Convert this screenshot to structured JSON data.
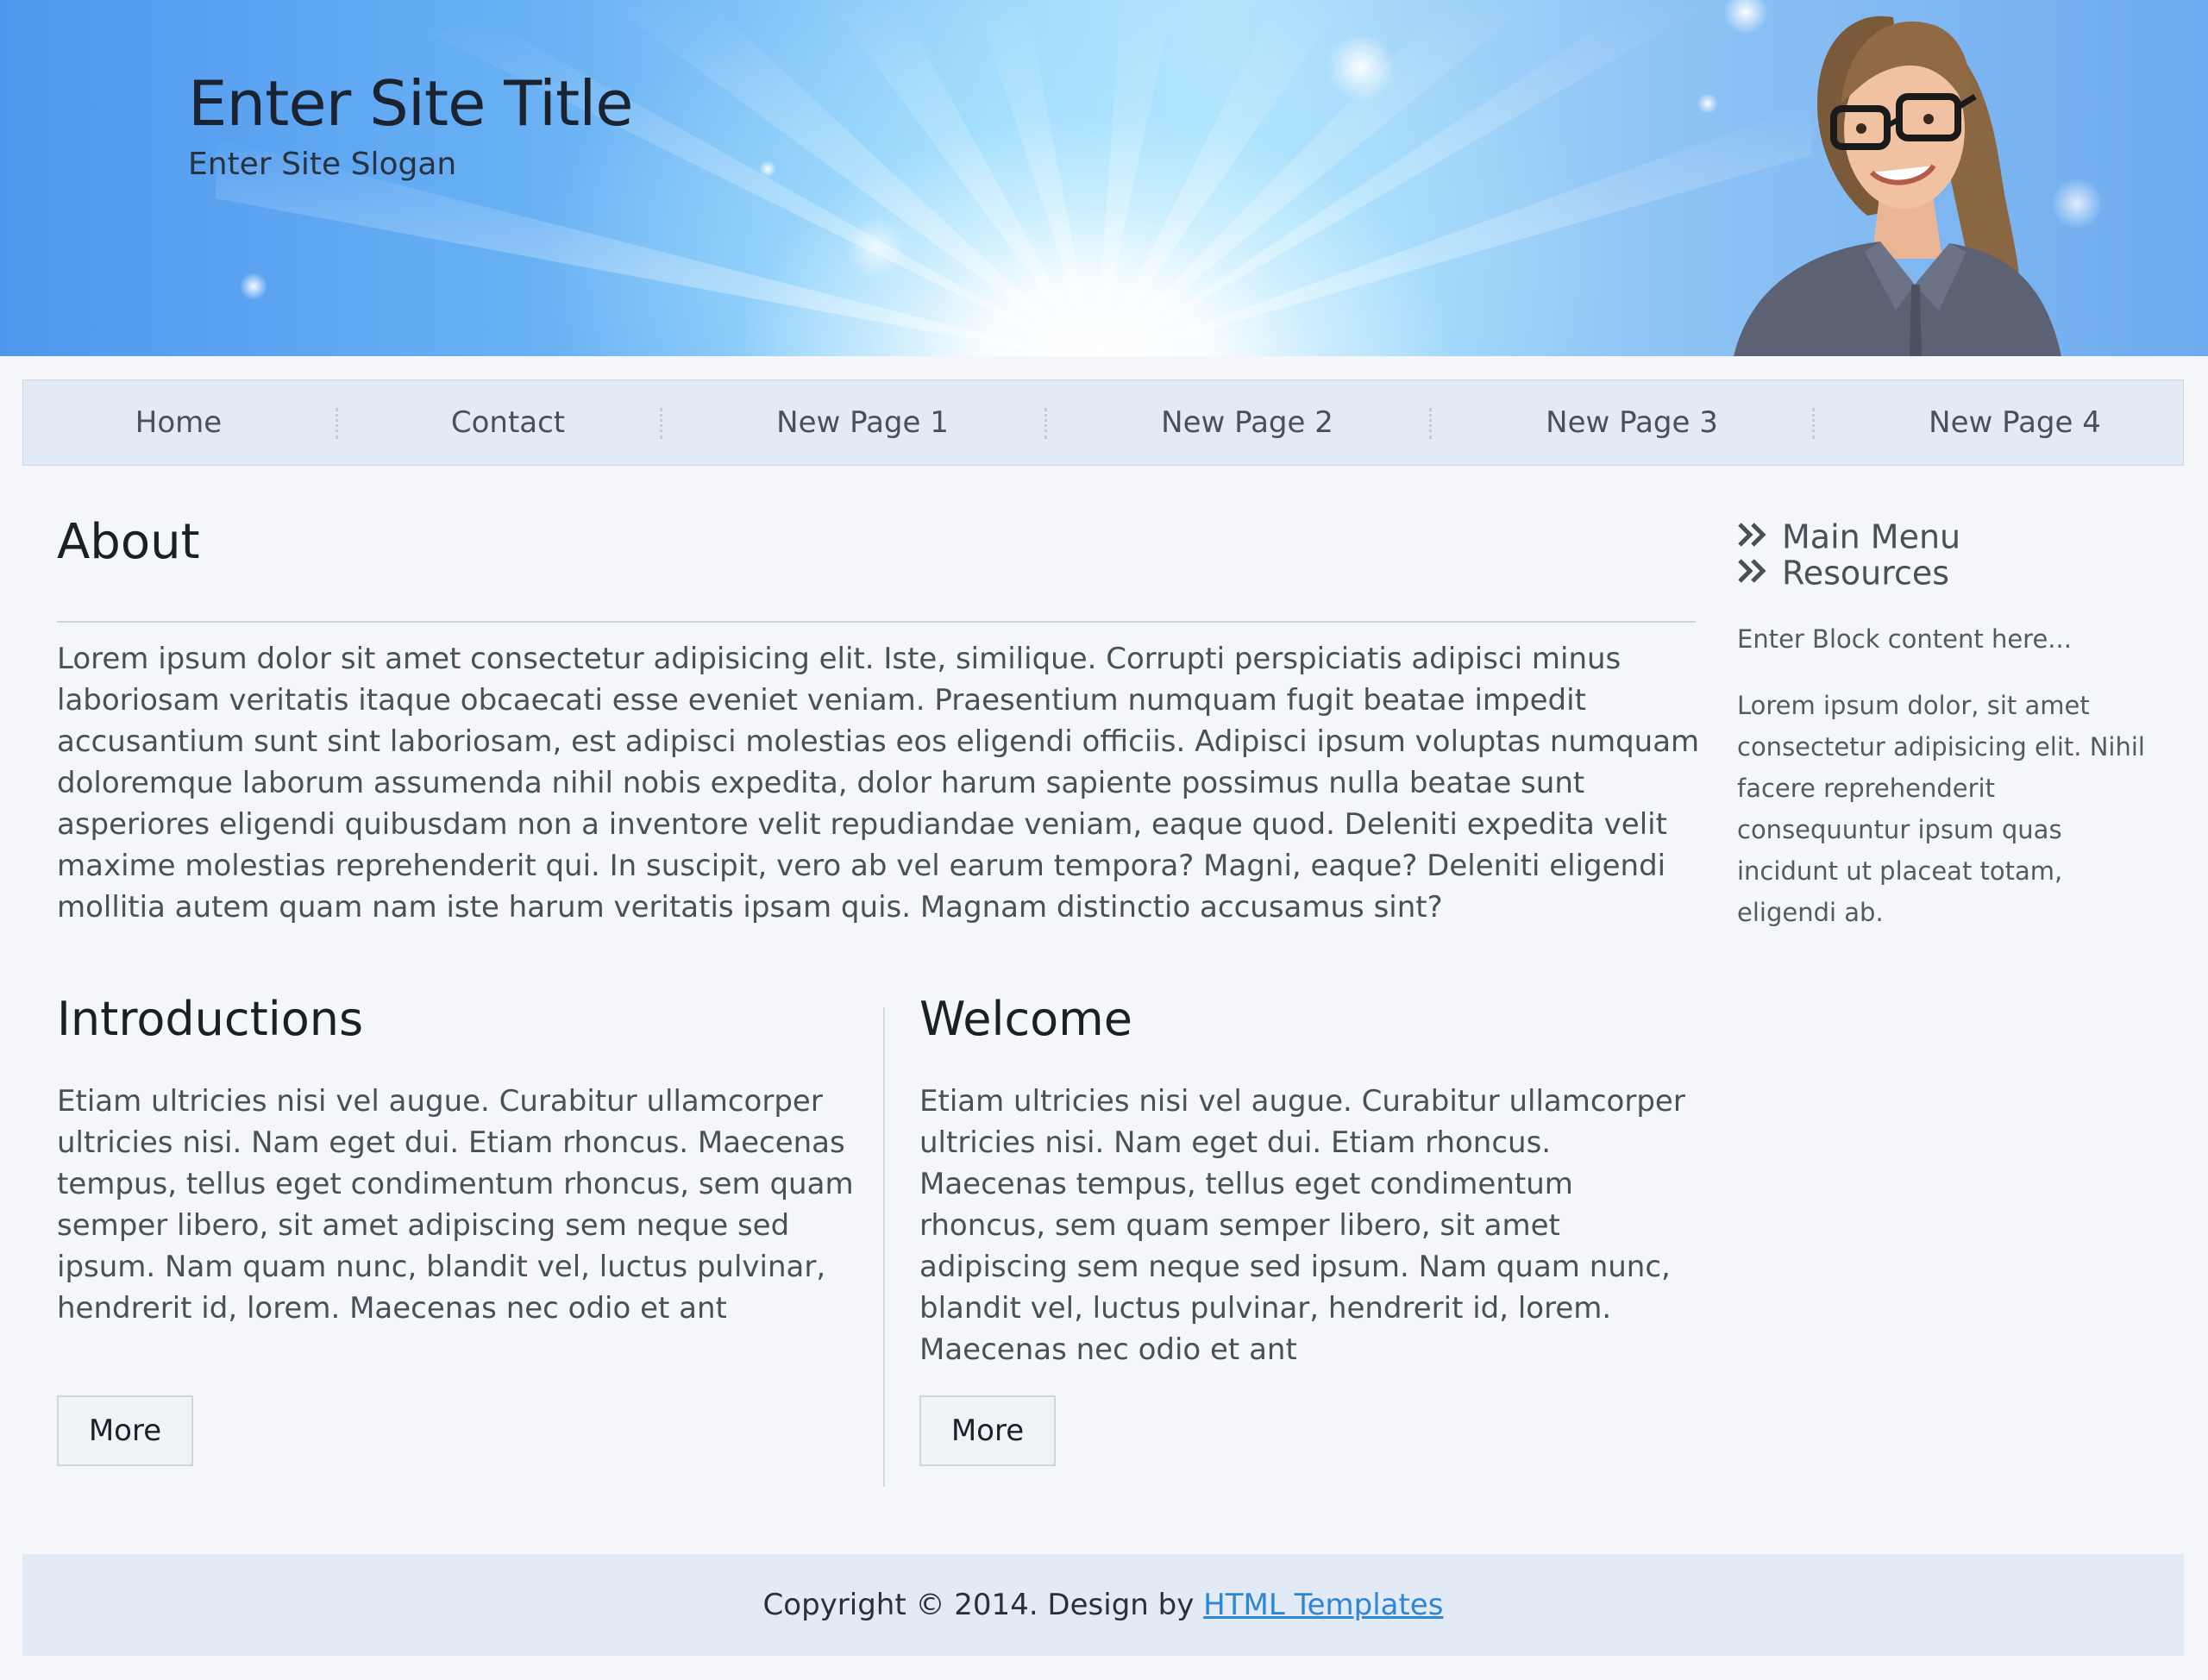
{
  "header": {
    "site_title": "Enter Site Title",
    "site_slogan": "Enter Site Slogan"
  },
  "nav": {
    "items": [
      {
        "label": "Home"
      },
      {
        "label": "Contact"
      },
      {
        "label": "New Page 1"
      },
      {
        "label": "New Page 2"
      },
      {
        "label": "New Page 3"
      },
      {
        "label": "New Page 4"
      }
    ]
  },
  "main": {
    "about": {
      "title": "About",
      "text": "Lorem ipsum dolor sit amet consectetur adipisicing elit. Iste, similique. Corrupti perspiciatis adipisci minus laboriosam veritatis itaque obcaecati esse eveniet veniam. Praesentium numquam fugit beatae impedit accusantium sunt sint laboriosam, est adipisci molestias eos eligendi officiis. Adipisci ipsum voluptas numquam doloremque laborum assumenda nihil nobis expedita, dolor harum sapiente possimus nulla beatae sunt asperiores eligendi quibusdam non a inventore velit repudiandae veniam, eaque quod. Deleniti expedita velit maxime molestias reprehenderit qui. In suscipit, vero ab vel earum tempora? Magni, eaque? Deleniti eligendi mollitia autem quam nam iste harum veritatis ipsam quis. Magnam distinctio accusamus sint?"
    },
    "columns": [
      {
        "title": "Introductions",
        "text": "Etiam ultricies nisi vel augue. Curabitur ullamcorper ultricies nisi. Nam eget dui. Etiam rhoncus. Maecenas tempus, tellus eget condimentum rhoncus, sem quam semper libero, sit amet adipiscing sem neque sed ipsum. Nam quam nunc, blandit vel, luctus pulvinar, hendrerit id, lorem. Maecenas nec odio et ant",
        "button": "More"
      },
      {
        "title": "Welcome",
        "text": "Etiam ultricies nisi vel augue. Curabitur ullamcorper ultricies nisi. Nam eget dui. Etiam rhoncus. Maecenas tempus, tellus eget condimentum rhoncus, sem quam semper libero, sit amet adipiscing sem neque sed ipsum. Nam quam nunc, blandit vel, luctus pulvinar, hendrerit id, lorem. Maecenas nec odio et ant",
        "button": "More"
      }
    ]
  },
  "sidebar": {
    "links": [
      {
        "label": "Main Menu",
        "icon": "double-chevron-right-icon"
      },
      {
        "label": "Resources",
        "icon": "double-chevron-right-icon"
      }
    ],
    "block_title": "Enter Block content here...",
    "block_text": "Lorem ipsum dolor, sit amet consectetur adipisicing elit. Nihil facere reprehenderit consequuntur ipsum quas incidunt ut placeat totam, eligendi ab."
  },
  "footer": {
    "text": "Copyright © 2014. Design by ",
    "link": "HTML Templates"
  },
  "colors": {
    "link": "#2f86d6",
    "nav_bg": "#e2ebf5",
    "page_bg": "#f4f6f9"
  }
}
